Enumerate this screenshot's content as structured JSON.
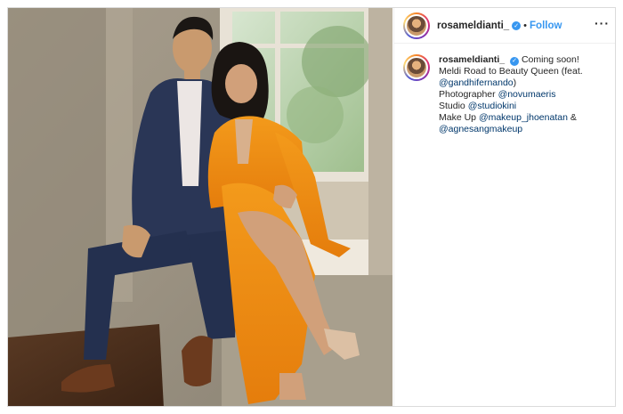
{
  "post": {
    "username": "rosameldianti_",
    "verified_icon": "verified-badge-icon",
    "separator": "•",
    "follow_label": "Follow",
    "more_label": "···",
    "caption": {
      "username": "rosameldianti_",
      "line1_text": "Coming soon!",
      "line2": "Meldi Road to Beauty Queen (feat.",
      "line3_tag": "@gandhifernando",
      "line3_end": ")",
      "line4_text": "Photographer ",
      "line4_tag": "@novumaeris",
      "line5_text": "Studio ",
      "line5_tag": "@studiokini",
      "line6_text": "Make Up ",
      "line6_tag": "@makeup_jhoenatan",
      "line6_end": " &",
      "line7_tag": "@agnesangmakeup"
    }
  },
  "colors": {
    "link": "#00376b",
    "follow": "#3897f0",
    "dress": "#f08c14",
    "suit": "#2a3656"
  }
}
